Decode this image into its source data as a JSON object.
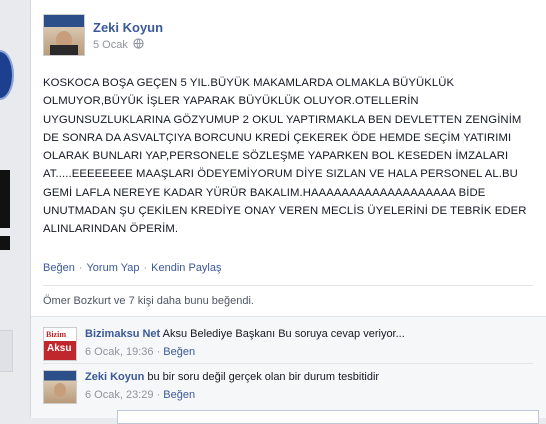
{
  "post": {
    "author": "Zeki Koyun",
    "date": "5 Ocak",
    "text": "KOSKOCA BOŞA GEÇEN 5 YIL.BÜYÜK MAKAMLARDA OLMAKLA BÜYÜKLÜK OLMUYOR,BÜYÜK İŞLER YAPARAK BÜYÜKLÜK OLUYOR.OTELLERİN UYGUNSUZLUKLARINA GÖZYUMUP 2 OKUL YAPTIRMAKLA BEN DEVLETTEN ZENGİNİM DE SONRA DA ASVALTÇIYA BORCUNU KREDİ ÇEKEREK ÖDE HEMDE SEÇİM YATIRIMI OLARAK BUNLARI YAP,PERSONELE SÖZLEŞME YAPARKEN BOL KESEDEN İMZALARI AT.....EEEEEEEE MAAŞLARI ÖDEYEMİYORUM DİYE SIZLAN VE HALA PERSONEL AL.BU GEMİ LAFLA NEREYE KADAR YÜRÜR BAKALIM.HAAAAAAAAAAAAAAAAAAA BİDE UNUTMADAN ŞU ÇEKİLEN KREDİYE ONAY VEREN MECLİS ÜYELERİNİ DE TEBRİK EDER ALINLARINDAN ÖPERİM."
  },
  "actions": {
    "like": "Beğen",
    "comment": "Yorum Yap",
    "share": "Kendin Paylaş",
    "sep": "·"
  },
  "likes_summary": "Ömer Bozkurt ve 7 kişi daha bunu beğendi.",
  "comments": [
    {
      "author": "Bizimaksu Net",
      "text": "Aksu Belediye Başkanı Bu soruya cevap veriyor...",
      "time": "6 Ocak, 19:36",
      "like": "Beğen",
      "avatar_text_top": "Bizim",
      "avatar_text_bottom": "Aksu"
    },
    {
      "author": "Zeki Koyun",
      "text": "bu bir soru değil gerçek olan bir durum tesbitidir",
      "time": "6 Ocak, 23:29",
      "like": "Beğen"
    }
  ],
  "icons": {
    "audience": "globe-icon"
  }
}
